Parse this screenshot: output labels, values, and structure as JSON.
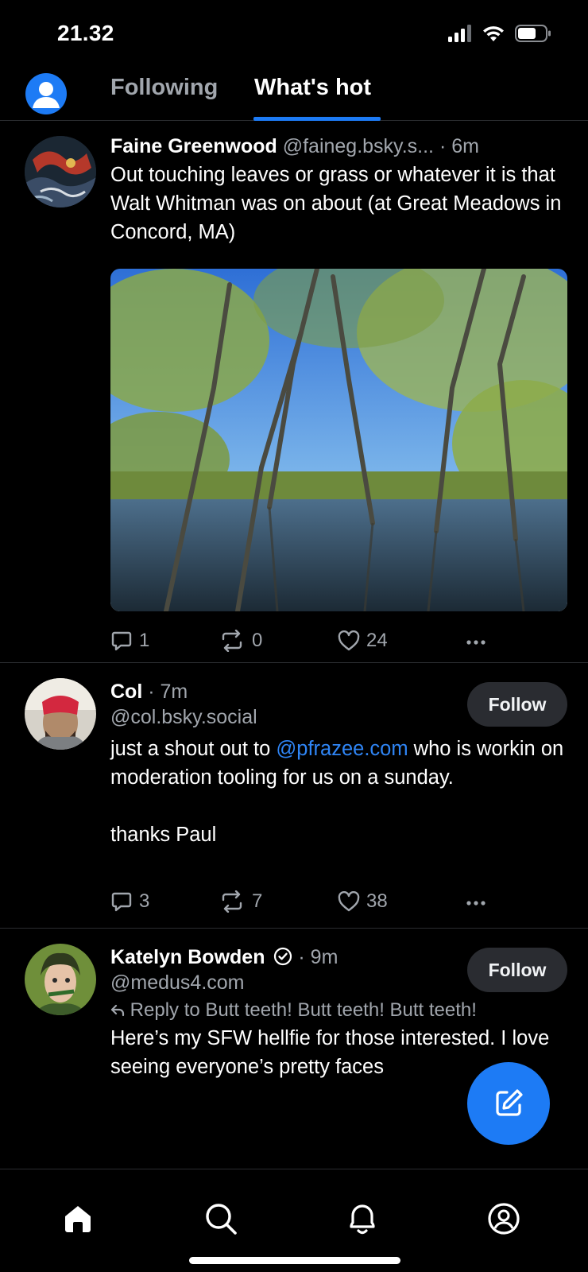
{
  "status_bar": {
    "time": "21.32"
  },
  "header": {
    "tabs": [
      {
        "label": "Following",
        "active": false
      },
      {
        "label": "What's hot",
        "active": true
      }
    ]
  },
  "posts": [
    {
      "author": "Faine Greenwood",
      "handle": "@faineg.bsky.s...",
      "time": "6m",
      "text": "Out touching leaves or grass or whatever it is that Walt Whitman was on about (at Great Meadows in Concord, MA)",
      "has_image": true,
      "replies": "1",
      "reposts": "0",
      "likes": "24"
    },
    {
      "author": "Col",
      "handle": "@col.bsky.social",
      "time": "7m",
      "follow_label": "Follow",
      "text_before": "just a shout out to ",
      "mention": "@pfrazee.com",
      "text_after": " who is workin on moderation tooling for us on a sunday.",
      "text_2": "thanks Paul",
      "replies": "3",
      "reposts": "7",
      "likes": "38"
    },
    {
      "author": "Katelyn Bowden",
      "handle": "@medus4.com",
      "time": "9m",
      "verified": true,
      "follow_label": "Follow",
      "reply_to": "Reply to Butt teeth! Butt teeth! Butt teeth!",
      "text": "Here’s my SFW hellfie for those interested. I love seeing everyone’s pretty faces",
      "has_image": true
    }
  ],
  "colors": {
    "accent": "#1d7bf5",
    "background": "#000000",
    "muted_text": "#a1a6ad",
    "divider": "#2b2d31",
    "follow_button_bg": "#2a2c31",
    "mention": "#2f85f5"
  },
  "icons": {
    "status": [
      "signal-icon",
      "wifi-icon",
      "battery-icon"
    ],
    "post_actions": [
      "reply-icon",
      "repost-icon",
      "like-icon",
      "more-icon"
    ],
    "fab": "compose-icon",
    "bottom_nav": [
      "home-icon",
      "search-icon",
      "notifications-icon",
      "profile-icon"
    ]
  }
}
